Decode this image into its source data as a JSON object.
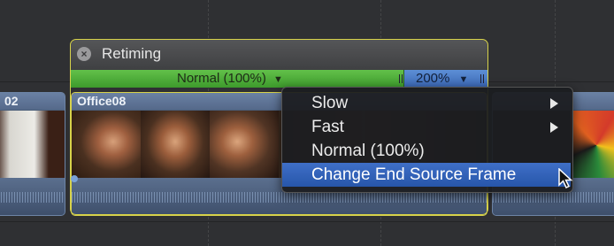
{
  "retiming": {
    "title": "Retiming",
    "normal_bar_label": "Normal (100%)",
    "fast_bar_label": "200%"
  },
  "clips": {
    "left_partial_name": "02",
    "main_name": "Office08"
  },
  "menu": {
    "items": [
      {
        "label": "Slow",
        "has_submenu": true
      },
      {
        "label": "Fast",
        "has_submenu": true
      },
      {
        "label": "Normal (100%)",
        "has_submenu": false
      },
      {
        "label": "Change End Source Frame",
        "has_submenu": false,
        "selected": true
      }
    ]
  },
  "colors": {
    "retime_outline": "#d7d24a",
    "speed_normal": "#4caf38",
    "speed_fast": "#4a7bc8",
    "menu_highlight": "#2f5fb8"
  }
}
